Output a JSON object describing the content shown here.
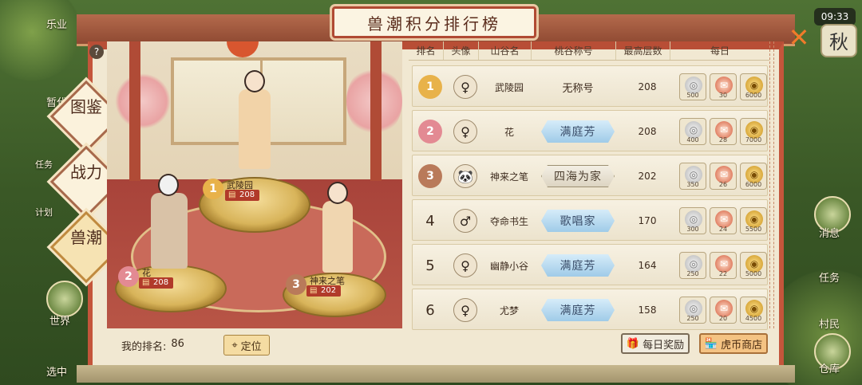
{
  "header": {
    "title": "兽潮积分排行榜"
  },
  "status": {
    "time": "09:33",
    "season": "秋"
  },
  "side_left": [
    "乐业",
    "暂代",
    "任务",
    "计划",
    "世界",
    "选中"
  ],
  "side_right": [
    "消息",
    "任务",
    "村民",
    "仓库"
  ],
  "tabs": [
    {
      "label": "图鉴",
      "active": false
    },
    {
      "label": "战力",
      "active": false
    },
    {
      "label": "兽潮",
      "active": true
    }
  ],
  "podium": [
    {
      "rank": "1",
      "name": "武陵园",
      "score": "208"
    },
    {
      "rank": "2",
      "name": "花",
      "score": "208"
    },
    {
      "rank": "3",
      "name": "神来之笔",
      "score": "202"
    }
  ],
  "table": {
    "headers": [
      "排名",
      "头像",
      "山谷名",
      "桃谷称号",
      "最高层数",
      "每日"
    ],
    "rows": [
      {
        "rank": "1",
        "name": "武陵园",
        "title": "无称号",
        "title_style": "plain",
        "floor": "208",
        "rewards": [
          "500",
          "30",
          "6000"
        ],
        "avatar": "♀"
      },
      {
        "rank": "2",
        "name": "花",
        "title": "满庭芳",
        "title_style": "blue",
        "floor": "208",
        "rewards": [
          "400",
          "28",
          "7000"
        ],
        "avatar": "♀"
      },
      {
        "rank": "3",
        "name": "神来之笔",
        "title": "四海为家",
        "title_style": "grey",
        "floor": "202",
        "rewards": [
          "350",
          "26",
          "6000"
        ],
        "avatar": "🐼"
      },
      {
        "rank": "4",
        "name": "夺命书生",
        "title": "歌唱家",
        "title_style": "blue",
        "floor": "170",
        "rewards": [
          "300",
          "24",
          "5500"
        ],
        "avatar": "♂"
      },
      {
        "rank": "5",
        "name": "幽静小谷",
        "title": "满庭芳",
        "title_style": "blue",
        "floor": "164",
        "rewards": [
          "250",
          "22",
          "5000"
        ],
        "avatar": "♀"
      },
      {
        "rank": "6",
        "name": "尤梦",
        "title": "满庭芳",
        "title_style": "blue",
        "floor": "158",
        "rewards": [
          "250",
          "20",
          "4500"
        ],
        "avatar": "♀"
      }
    ]
  },
  "footer": {
    "my_rank_label": "我的排名:",
    "my_rank_value": "86",
    "locate_label": "定位",
    "daily_reward_label": "每日奖励",
    "shop_label": "虎币商店"
  },
  "icons": {
    "close": "close-icon",
    "help": "help-icon",
    "locate": "location-pin-icon",
    "gift": "gift-icon",
    "shop": "shop-icon"
  },
  "colors": {
    "accent": "#b84e36",
    "title_blue": "#9fcbe8",
    "rank1": "#e8b24a",
    "rank2": "#e38a93",
    "rank3": "#b97a5a"
  }
}
